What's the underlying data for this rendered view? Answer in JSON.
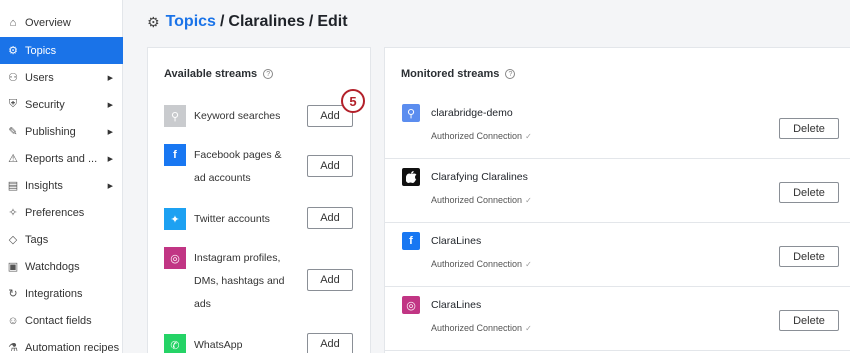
{
  "sidebar": {
    "items": [
      {
        "label": "Overview",
        "icon": "home-icon",
        "glyph": "⌂",
        "caret": false,
        "active": false
      },
      {
        "label": "Topics",
        "icon": "gear-icon",
        "glyph": "⚙",
        "caret": false,
        "active": true
      },
      {
        "label": "Users",
        "icon": "users-icon",
        "glyph": "⚇",
        "caret": true,
        "active": false
      },
      {
        "label": "Security",
        "icon": "shield-icon",
        "glyph": "⛨",
        "caret": true,
        "active": false
      },
      {
        "label": "Publishing",
        "icon": "edit-icon",
        "glyph": "✎",
        "caret": true,
        "active": false
      },
      {
        "label": "Reports and ...",
        "icon": "warning-icon",
        "glyph": "⚠",
        "caret": true,
        "active": false
      },
      {
        "label": "Insights",
        "icon": "bar-chart-icon",
        "glyph": "▤",
        "caret": true,
        "active": false
      },
      {
        "label": "Preferences",
        "icon": "wrench-icon",
        "glyph": "✧",
        "caret": false,
        "active": false
      },
      {
        "label": "Tags",
        "icon": "tag-icon",
        "glyph": "◇",
        "caret": false,
        "active": false
      },
      {
        "label": "Watchdogs",
        "icon": "watchdog-icon",
        "glyph": "▣",
        "caret": false,
        "active": false
      },
      {
        "label": "Integrations",
        "icon": "integrations-icon",
        "glyph": "↻",
        "caret": false,
        "active": false
      },
      {
        "label": "Contact fields",
        "icon": "person-icon",
        "glyph": "☺",
        "caret": false,
        "active": false
      },
      {
        "label": "Automation recipes",
        "icon": "automation-icon",
        "glyph": "⚗",
        "caret": false,
        "active": false
      }
    ],
    "caret_glyph": "▶"
  },
  "header": {
    "gear_glyph": "⚙",
    "crumb_link": "Topics",
    "separator": "/",
    "crumb_topic": "Claralines",
    "crumb_action": "Edit"
  },
  "available": {
    "title": "Available streams",
    "help_glyph": "?",
    "streams": [
      {
        "line1": "Keyword searches",
        "line2": "",
        "line3": "",
        "icon": "search-icon",
        "glyph": "⚲",
        "color": "#c9cbce",
        "add_label": "Add"
      },
      {
        "line1": "Facebook pages &",
        "line2": "ad accounts",
        "line3": "",
        "icon": "facebook-icon",
        "glyph": "f",
        "color": "#1877f2",
        "add_label": "Add"
      },
      {
        "line1": "Twitter accounts",
        "line2": "",
        "line3": "",
        "icon": "twitter-icon",
        "glyph": "✦",
        "color": "#1da1f2",
        "add_label": "Add"
      },
      {
        "line1": "Instagram profiles,",
        "line2": "DMs, hashtags and",
        "line3": "ads",
        "icon": "instagram-icon",
        "glyph": "◎",
        "color": "#c13584",
        "add_label": "Add"
      },
      {
        "line1": "WhatsApp",
        "line2": "",
        "line3": "",
        "icon": "whatsapp-icon",
        "glyph": "✆",
        "color": "#25d366",
        "add_label": "Add"
      }
    ]
  },
  "monitored": {
    "title": "Monitored streams",
    "help_glyph": "?",
    "status_check": "✓",
    "streams": [
      {
        "name": "clarabridge-demo",
        "status": "Authorized Connection",
        "icon": "search-icon",
        "glyph": "⚲",
        "color": "#5b8def",
        "delete_label": "Delete"
      },
      {
        "name": "Clarafying Claralines",
        "status": "Authorized Connection",
        "icon": "apple-icon",
        "glyph": "",
        "color": "#111111",
        "delete_label": "Delete"
      },
      {
        "name": "ClaraLines",
        "status": "Authorized Connection",
        "icon": "facebook-icon",
        "glyph": "f",
        "color": "#1877f2",
        "delete_label": "Delete"
      },
      {
        "name": "ClaraLines",
        "status": "Authorized Connection",
        "icon": "instagram-icon",
        "glyph": "◎",
        "color": "#c13584",
        "delete_label": "Delete"
      }
    ]
  },
  "step_badge": "5"
}
